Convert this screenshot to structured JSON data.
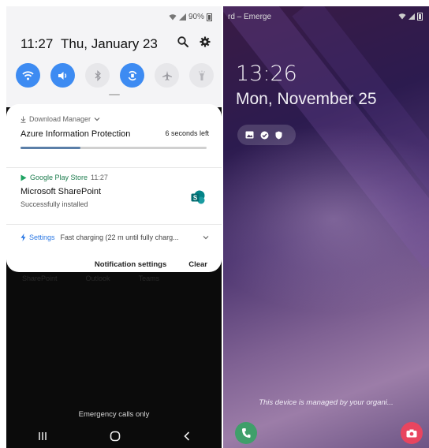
{
  "left_screen": {
    "status_bar": {
      "battery": "90%",
      "icons": [
        "wifi-icon",
        "signal-icon",
        "battery-icon"
      ]
    },
    "quick_panel": {
      "time": "11:27",
      "date": "Thu, January 23",
      "top_icons": [
        "search-icon",
        "gear-icon"
      ],
      "tiles": [
        {
          "name": "wifi-icon",
          "state": "on"
        },
        {
          "name": "sound-icon",
          "state": "on"
        },
        {
          "name": "bluetooth-icon",
          "state": "off"
        },
        {
          "name": "auto-rotate-icon",
          "state": "on"
        },
        {
          "name": "airplane-icon",
          "state": "off"
        },
        {
          "name": "flashlight-icon",
          "state": "off"
        }
      ]
    },
    "notifications": [
      {
        "app": "Download Manager",
        "title": "Azure Information Protection",
        "right_text": "6 seconds left",
        "progress": 0.32
      },
      {
        "app": "Google Play Store",
        "time": "11:27",
        "title": "Microsoft SharePoint",
        "subtitle": "Successfully installed"
      },
      {
        "app": "Settings",
        "text": "Fast charging (22 m until fully charg..."
      }
    ],
    "actions": {
      "settings_label": "Notification settings",
      "clear_label": "Clear"
    },
    "background_text": {
      "left": "SharePoint",
      "middle": "Outlook",
      "right": "Teams"
    },
    "emergency": "Emergency calls only"
  },
  "right_screen": {
    "status_left": "rd – Emerge",
    "time": "13:26",
    "date": "Mon, November 25",
    "notif_icons": [
      "image-icon",
      "check-icon",
      "shield-icon"
    ],
    "managed_text": "This device is managed by your organi...",
    "colors": {
      "phone_button": "#3f9f6a",
      "camera_button": "#e8455f",
      "tile_on": "#3d8bf2"
    }
  }
}
